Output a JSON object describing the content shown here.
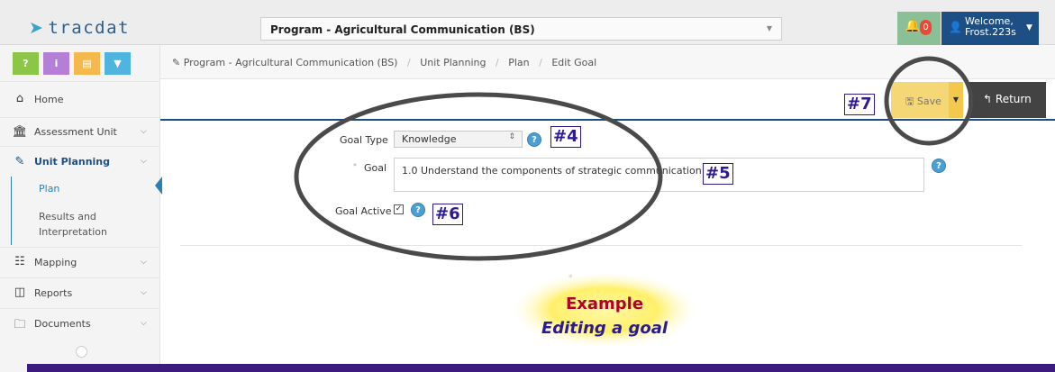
{
  "header": {
    "logo": "tracdat",
    "program_select": "Program - Agricultural Communication (BS)",
    "notifications_count": "0",
    "welcome_line1": "Welcome,",
    "welcome_line2": "Frost.223s"
  },
  "toolbar_icons": [
    "?",
    "i",
    "list-icon",
    "filter-icon"
  ],
  "sidebar": {
    "items": [
      {
        "label": "Home",
        "icon": "home-icon"
      },
      {
        "label": "Assessment Unit",
        "icon": "building-icon"
      },
      {
        "label": "Unit Planning",
        "icon": "pencil-icon"
      },
      {
        "label": "Mapping",
        "icon": "sitemap-icon"
      },
      {
        "label": "Reports",
        "icon": "table-icon"
      },
      {
        "label": "Documents",
        "icon": "folder-icon"
      }
    ],
    "sub_items": [
      "Plan",
      "Results and",
      "Interpretation"
    ]
  },
  "breadcrumb": [
    "Program - Agricultural Communication (BS)",
    "Unit Planning",
    "Plan",
    "Edit Goal"
  ],
  "actions": {
    "save": "Save",
    "return": "Return"
  },
  "form": {
    "goal_type_label": "Goal Type",
    "goal_type_value": "Knowledge",
    "goal_label": "Goal",
    "goal_value": "1.0 Understand the components of strategic communication plans.",
    "goal_active_label": "Goal Active",
    "goal_active_checked": true
  },
  "callouts": {
    "c4": "#4",
    "c5": "#5",
    "c6": "#6",
    "c7": "#7"
  },
  "example": {
    "line1": "Example",
    "line2": "Editing a goal"
  },
  "colors": {
    "navy": "#1d4f85",
    "accent_purple": "#2c1b8e",
    "save_yellow": "#f6d775",
    "banner_yellow": "#fff06a"
  }
}
